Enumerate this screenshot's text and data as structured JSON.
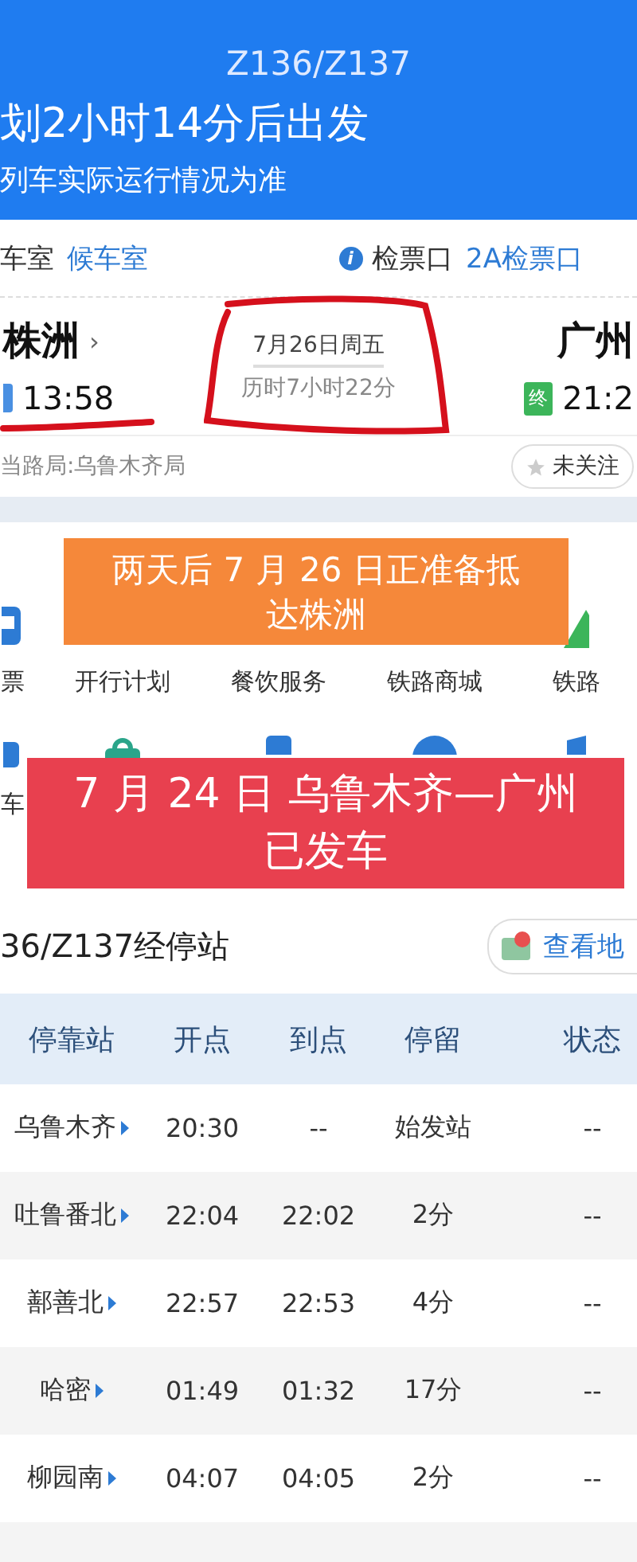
{
  "header": {
    "train": "Z136/Z137",
    "countdown": "划2小时14分后出发",
    "note": "列车实际运行情况为准"
  },
  "info_row": {
    "waiting_label": "车室",
    "waiting_value": "候车室",
    "gate_label": "检票口",
    "gate_value": "2A检票口"
  },
  "info_icon": "i",
  "journey": {
    "from_station": "株洲",
    "from_more": "›",
    "from_time": "13:58",
    "date": "7月26日周五",
    "duration": "历时7小时22分",
    "to_badge": "终",
    "to_station": "广州",
    "to_time": "21:2"
  },
  "bureau": "当路局:乌鲁木齐局",
  "follow_button": "未关注",
  "services": [
    {
      "kind": "bus",
      "label": "票"
    },
    {
      "kind": "none",
      "label": "开行计划"
    },
    {
      "kind": "none",
      "label": "餐饮服务"
    },
    {
      "kind": "none",
      "label": "铁路商城"
    },
    {
      "kind": "mountain",
      "label": "铁路"
    }
  ],
  "services_row2": [
    {
      "kind": "car",
      "label": "车"
    },
    {
      "kind": "bag"
    },
    {
      "kind": "phone"
    },
    {
      "kind": "circle"
    },
    {
      "kind": "shield"
    }
  ],
  "banners": [
    {
      "text": "两天后 7 月 26 日正准备抵达株洲",
      "color": "#f5883a"
    },
    {
      "text": "7 月 24 日 乌鲁木齐—广州已发车",
      "color": "#e8404f"
    }
  ],
  "stops": {
    "title": "36/Z137经停站",
    "map_button": "查看地",
    "columns": [
      "停靠站",
      "开点",
      "到点",
      "停留",
      "状态"
    ],
    "rows": [
      [
        "乌鲁木齐",
        "20:30",
        "--",
        "始发站",
        "--"
      ],
      [
        "吐鲁番北",
        "22:04",
        "22:02",
        "2分",
        "--"
      ],
      [
        "鄯善北",
        "22:57",
        "22:53",
        "4分",
        "--"
      ],
      [
        "哈密",
        "01:49",
        "01:32",
        "17分",
        "--"
      ],
      [
        "柳园南",
        "04:07",
        "04:05",
        "2分",
        "--"
      ]
    ]
  }
}
